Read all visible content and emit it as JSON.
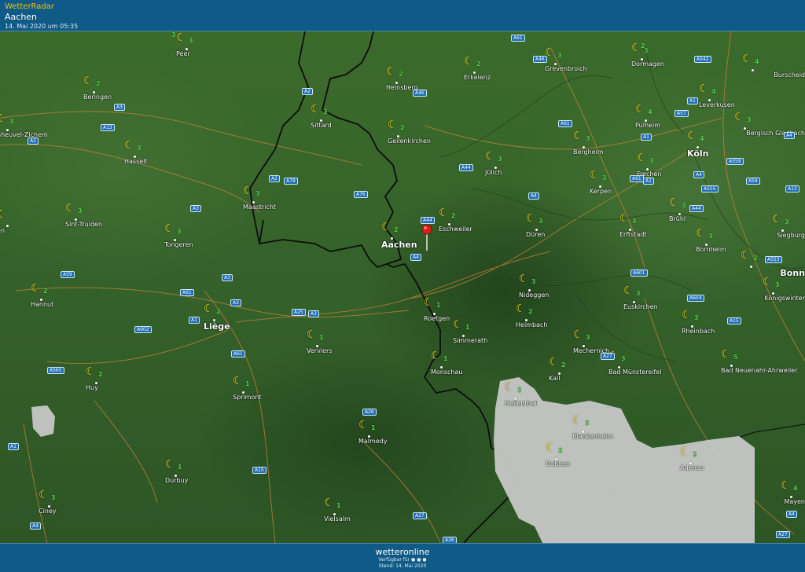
{
  "header": {
    "app_name": "WetterRadar",
    "location": "Aachen",
    "timestamp": "14. Mai 2020 um 05:35"
  },
  "footer": {
    "brand": "wetteronline",
    "available_for": "Verfügbar für",
    "stand": "Stand: 14. Mai 2020"
  },
  "icons": {
    "weather": "moon-icon",
    "marker": "map-pin-icon"
  },
  "colors": {
    "moon": "#f5d213",
    "wind": "#4fd148",
    "road": "#1f6fb2",
    "bar": "#0f5a86"
  },
  "map": {
    "selected_location": "Aachen",
    "cities": [
      {
        "name": "Peer",
        "wind": "3"
      },
      {
        "name": "Beringen",
        "wind": "2"
      },
      {
        "name": "Heinsberg",
        "wind": "2"
      },
      {
        "name": "Erkelenz",
        "wind": "2"
      },
      {
        "name": "Grevenbroich",
        "wind": "3"
      },
      {
        "name": "Dormagen",
        "wind": "3"
      },
      {
        "name": "Burscheid",
        "wind": "4"
      },
      {
        "name": "Leverkusen",
        "wind": "4"
      },
      {
        "name": "Pulheim",
        "wind": "4"
      },
      {
        "name": "Bergisch Gladbach",
        "wind": "3"
      },
      {
        "name": "Köln",
        "wind": "4"
      },
      {
        "name": "nheuvel-Zichem",
        "wind": "3"
      },
      {
        "name": "Hasselt",
        "wind": "3"
      },
      {
        "name": "Sittard",
        "wind": "3"
      },
      {
        "name": "Geilenkirchen",
        "wind": "2"
      },
      {
        "name": "Bergheim",
        "wind": "3"
      },
      {
        "name": "Jülich",
        "wind": "3"
      },
      {
        "name": "Frechen",
        "wind": "3"
      },
      {
        "name": "Kerpen",
        "wind": "3"
      },
      {
        "name": "Maastricht",
        "wind": "3"
      },
      {
        "name": "Eschweiler",
        "wind": "2"
      },
      {
        "name": "Düren",
        "wind": "3"
      },
      {
        "name": "Brühl",
        "wind": "3"
      },
      {
        "name": "Erftstadt",
        "wind": "3"
      },
      {
        "name": "Siegburg",
        "wind": "3"
      },
      {
        "name": "Sint-Truiden",
        "wind": "3"
      },
      {
        "name": "Tongeren",
        "wind": "3"
      },
      {
        "name": "Aachen",
        "wind": "2"
      },
      {
        "name": "Bornheim",
        "wind": "3"
      },
      {
        "name": "Bonn",
        "wind": "2"
      },
      {
        "name": "Hannut",
        "wind": "2"
      },
      {
        "name": "Nideggen",
        "wind": "3"
      },
      {
        "name": "Euskirchen",
        "wind": "3"
      },
      {
        "name": "Königswinter",
        "wind": "3"
      },
      {
        "name": "Liège",
        "wind": "2"
      },
      {
        "name": "Roetgen",
        "wind": "1"
      },
      {
        "name": "Heimbach",
        "wind": "2"
      },
      {
        "name": "Rheinbach",
        "wind": "3"
      },
      {
        "name": "Verviers",
        "wind": "1"
      },
      {
        "name": "Simmerath",
        "wind": "1"
      },
      {
        "name": "Mechernich",
        "wind": "3"
      },
      {
        "name": "Monschau",
        "wind": "1"
      },
      {
        "name": "Kall",
        "wind": "2"
      },
      {
        "name": "Bad Münstereifel",
        "wind": "3"
      },
      {
        "name": "Bad Neuenahr-Ahrweiler",
        "wind": "5"
      },
      {
        "name": "Huy",
        "wind": "2"
      },
      {
        "name": "Sprimont",
        "wind": "1"
      },
      {
        "name": "Hellenthal",
        "wind": "2"
      },
      {
        "name": "Malmedy",
        "wind": "1"
      },
      {
        "name": "Blankenheim",
        "wind": "2"
      },
      {
        "name": "Dahlem",
        "wind": "2"
      },
      {
        "name": "Adenau",
        "wind": "2"
      },
      {
        "name": "Durbuy",
        "wind": "1"
      },
      {
        "name": "Ciney",
        "wind": "3"
      },
      {
        "name": "Vielsalm",
        "wind": "1"
      },
      {
        "name": "Mayen",
        "wind": "4"
      },
      {
        "name": "en",
        "wind": ""
      }
    ],
    "extra_wind": [
      "3",
      "2"
    ],
    "roads": [
      "A61",
      "A46",
      "A542",
      "A2",
      "A46",
      "A1",
      "A57",
      "A3",
      "A13",
      "A61",
      "A1",
      "A4",
      "A2",
      "A44",
      "A559",
      "A4",
      "A2",
      "A79",
      "A76",
      "A44",
      "A4",
      "A61",
      "A1",
      "A555",
      "A59",
      "A3",
      "A13",
      "A4",
      "A44",
      "A553",
      "A59",
      "A3",
      "A601",
      "A61",
      "A3",
      "A25",
      "A3",
      "A27",
      "A1",
      "A602",
      "A604",
      "A15",
      "A61",
      "A565",
      "A26",
      "A1",
      "A15",
      "A27",
      "A4",
      "A26",
      "A27",
      "A4",
      "A60",
      "A48"
    ]
  }
}
